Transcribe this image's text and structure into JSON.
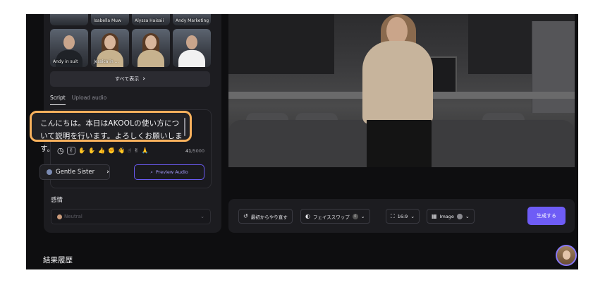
{
  "avatars_row1": [
    {
      "name": ""
    },
    {
      "name": "Isabella Muw"
    },
    {
      "name": "Alyssa Haisaii"
    },
    {
      "name": "Andy Marketing"
    }
  ],
  "avatars_row2": [
    {
      "name": "Andy in suit"
    },
    {
      "name": "Jessica in ..."
    },
    {
      "name": ""
    },
    {
      "name": ""
    }
  ],
  "show_all": {
    "label": "すべて表示"
  },
  "tabs": [
    {
      "label": "Script",
      "active": true
    },
    {
      "label": "Upload audio",
      "active": false
    }
  ],
  "script": {
    "text": "こんにちは。本日はAKOOLの使い方について説明を行います。よろしくお願いします。",
    "char_count": "41",
    "char_limit": "/5000"
  },
  "voice": {
    "name": "Gentle Sister"
  },
  "preview_audio": {
    "label": "Preview Audio"
  },
  "emotion": {
    "label": "感情",
    "value": "Neutral"
  },
  "toolbar": {
    "restart": "最初からやり直す",
    "faceswap": "フェイススワップ",
    "faceswap_count": "0",
    "ratio": "16:9",
    "image": "Image",
    "generate": "生成する"
  },
  "history": {
    "title": "結果履歴"
  },
  "colors": {
    "accent": "#6e5cf6",
    "highlight_border": "#f7b15d",
    "panel_bg": "#1c1c20",
    "app_bg": "#0e0e10"
  }
}
